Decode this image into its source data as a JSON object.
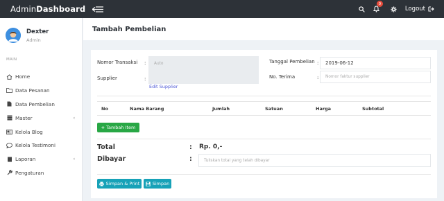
{
  "brand": {
    "prefix": "Admin",
    "bold": "Dashboard"
  },
  "topbar": {
    "notification_count": "0",
    "logout_label": "Logout"
  },
  "user": {
    "name": "Dexter",
    "role": "Admin"
  },
  "sidebar": {
    "section_label": "MAIN",
    "items": [
      {
        "label": "Home",
        "icon": "home-icon"
      },
      {
        "label": "Data Pesanan",
        "icon": "folder-icon"
      },
      {
        "label": "Data Pembelian",
        "icon": "file-icon"
      },
      {
        "label": "Master",
        "icon": "database-icon",
        "caret": "‹"
      },
      {
        "label": "Kelola Blog",
        "icon": "newspaper-icon"
      },
      {
        "label": "Kelola Testimoni",
        "icon": "comment-icon"
      },
      {
        "label": "Laporan",
        "icon": "book-icon",
        "caret": "‹"
      },
      {
        "label": "Pengaturan",
        "icon": "wrench-icon"
      }
    ]
  },
  "page": {
    "title": "Tambah Pembelian"
  },
  "form": {
    "nomor_transaksi": {
      "label": "Nomor Transaksi",
      "colon": ":",
      "placeholder": "Auto"
    },
    "supplier": {
      "label": "Supplier",
      "colon": ":",
      "value": "",
      "link": "Edit Supplier"
    },
    "tanggal": {
      "label": "Tanggal Pembelian",
      "colon": ":",
      "value": "2019-06-12"
    },
    "no_terima": {
      "label": "No. Terima",
      "colon": ":",
      "placeholder": "Nomor faktur supplier"
    }
  },
  "table": {
    "headers": [
      "No",
      "Nama Barang",
      "Jumlah",
      "Satuan",
      "Harga",
      "Subtotal"
    ],
    "rows": []
  },
  "actions": {
    "add_item": "Tambah Item",
    "save_print": "Simpan & Print",
    "save": "Simpan"
  },
  "totals": {
    "total_label": "Total",
    "total_colon": ":",
    "total_value": "Rp. 0,-",
    "paid_label": "Dibayar",
    "paid_colon": ":",
    "paid_placeholder": "Tuliskan total yang telah dibayar"
  },
  "colors": {
    "topbar": "#2d3238",
    "green": "#28a745",
    "teal": "#17a2b8",
    "link": "#4c57d6",
    "badge": "#e74c3c"
  }
}
